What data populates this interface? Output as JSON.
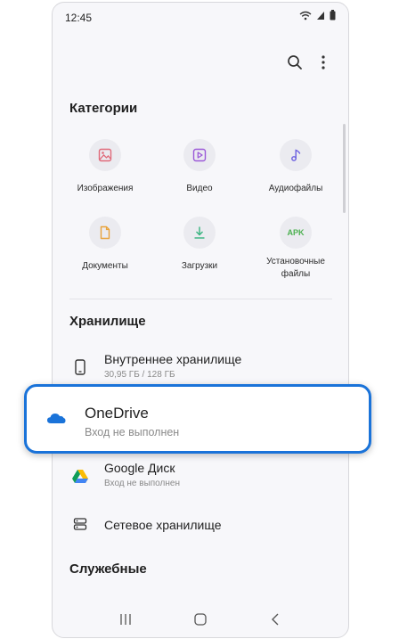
{
  "status_bar": {
    "time": "12:45"
  },
  "header": {
    "search_icon": "search-icon",
    "more_icon": "more-vert-icon"
  },
  "categories": {
    "title": "Категории",
    "items": [
      {
        "label": "Изображения",
        "icon": "image-icon",
        "color": "#e06a7a"
      },
      {
        "label": "Видео",
        "icon": "video-icon",
        "color": "#9b59d8"
      },
      {
        "label": "Аудиофайлы",
        "icon": "audio-icon",
        "color": "#6a5ee0"
      },
      {
        "label": "Документы",
        "icon": "document-icon",
        "color": "#e8a23a"
      },
      {
        "label": "Загрузки",
        "icon": "download-icon",
        "color": "#36b37e"
      },
      {
        "label": "Установочные файлы",
        "icon": "apk-icon",
        "icon_text": "APK",
        "color": "#4cb050"
      }
    ]
  },
  "storage": {
    "title": "Хранилище",
    "internal": {
      "title": "Внутреннее хранилище",
      "subtitle": "30,95 ГБ / 128 ГБ"
    },
    "onedrive": {
      "title": "OneDrive",
      "subtitle": "Вход не выполнен",
      "color": "#1a73d9"
    },
    "google": {
      "title": "Google Диск",
      "subtitle": "Вход не выполнен"
    },
    "network": {
      "title": "Сетевое хранилище"
    }
  },
  "utilities": {
    "title": "Служебные"
  },
  "navigation": {
    "recents": "recents-icon",
    "home": "home-icon",
    "back": "back-icon"
  }
}
